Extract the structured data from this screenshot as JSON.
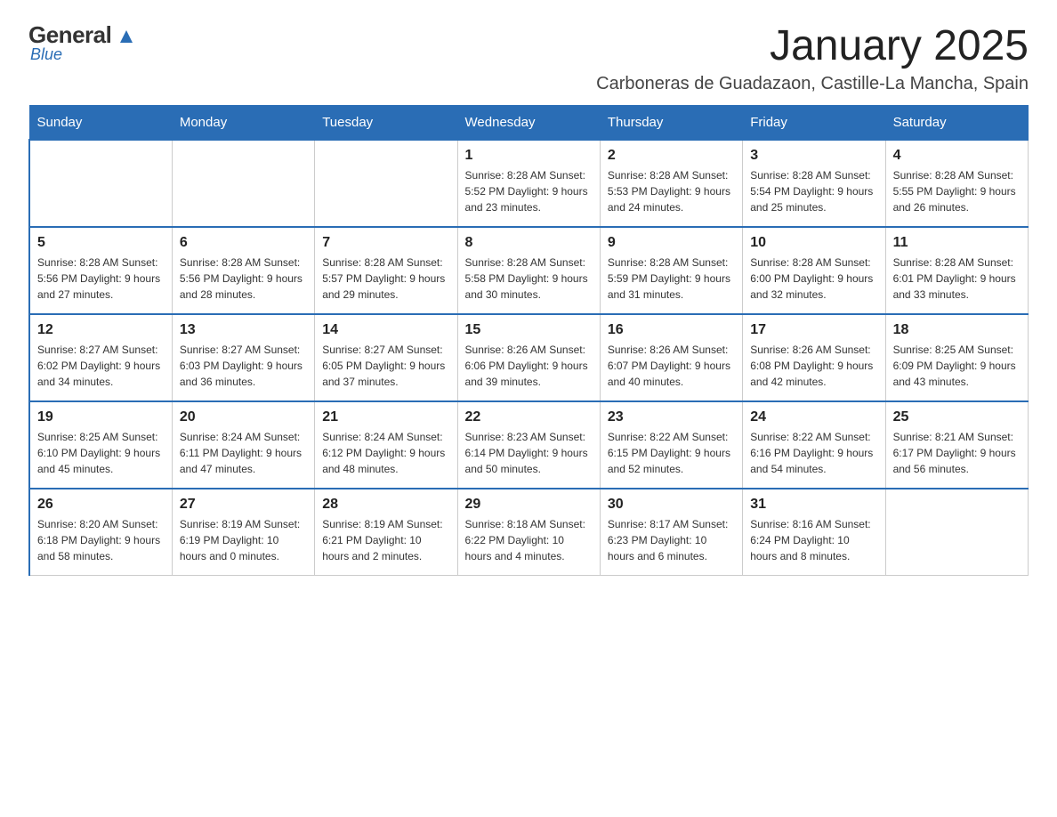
{
  "logo": {
    "brand1": "General",
    "brand2": "Blue"
  },
  "header": {
    "month_year": "January 2025",
    "location": "Carboneras de Guadazaon, Castille-La Mancha, Spain"
  },
  "weekdays": [
    "Sunday",
    "Monday",
    "Tuesday",
    "Wednesday",
    "Thursday",
    "Friday",
    "Saturday"
  ],
  "weeks": [
    [
      {
        "day": "",
        "info": ""
      },
      {
        "day": "",
        "info": ""
      },
      {
        "day": "",
        "info": ""
      },
      {
        "day": "1",
        "info": "Sunrise: 8:28 AM\nSunset: 5:52 PM\nDaylight: 9 hours and 23 minutes."
      },
      {
        "day": "2",
        "info": "Sunrise: 8:28 AM\nSunset: 5:53 PM\nDaylight: 9 hours and 24 minutes."
      },
      {
        "day": "3",
        "info": "Sunrise: 8:28 AM\nSunset: 5:54 PM\nDaylight: 9 hours and 25 minutes."
      },
      {
        "day": "4",
        "info": "Sunrise: 8:28 AM\nSunset: 5:55 PM\nDaylight: 9 hours and 26 minutes."
      }
    ],
    [
      {
        "day": "5",
        "info": "Sunrise: 8:28 AM\nSunset: 5:56 PM\nDaylight: 9 hours and 27 minutes."
      },
      {
        "day": "6",
        "info": "Sunrise: 8:28 AM\nSunset: 5:56 PM\nDaylight: 9 hours and 28 minutes."
      },
      {
        "day": "7",
        "info": "Sunrise: 8:28 AM\nSunset: 5:57 PM\nDaylight: 9 hours and 29 minutes."
      },
      {
        "day": "8",
        "info": "Sunrise: 8:28 AM\nSunset: 5:58 PM\nDaylight: 9 hours and 30 minutes."
      },
      {
        "day": "9",
        "info": "Sunrise: 8:28 AM\nSunset: 5:59 PM\nDaylight: 9 hours and 31 minutes."
      },
      {
        "day": "10",
        "info": "Sunrise: 8:28 AM\nSunset: 6:00 PM\nDaylight: 9 hours and 32 minutes."
      },
      {
        "day": "11",
        "info": "Sunrise: 8:28 AM\nSunset: 6:01 PM\nDaylight: 9 hours and 33 minutes."
      }
    ],
    [
      {
        "day": "12",
        "info": "Sunrise: 8:27 AM\nSunset: 6:02 PM\nDaylight: 9 hours and 34 minutes."
      },
      {
        "day": "13",
        "info": "Sunrise: 8:27 AM\nSunset: 6:03 PM\nDaylight: 9 hours and 36 minutes."
      },
      {
        "day": "14",
        "info": "Sunrise: 8:27 AM\nSunset: 6:05 PM\nDaylight: 9 hours and 37 minutes."
      },
      {
        "day": "15",
        "info": "Sunrise: 8:26 AM\nSunset: 6:06 PM\nDaylight: 9 hours and 39 minutes."
      },
      {
        "day": "16",
        "info": "Sunrise: 8:26 AM\nSunset: 6:07 PM\nDaylight: 9 hours and 40 minutes."
      },
      {
        "day": "17",
        "info": "Sunrise: 8:26 AM\nSunset: 6:08 PM\nDaylight: 9 hours and 42 minutes."
      },
      {
        "day": "18",
        "info": "Sunrise: 8:25 AM\nSunset: 6:09 PM\nDaylight: 9 hours and 43 minutes."
      }
    ],
    [
      {
        "day": "19",
        "info": "Sunrise: 8:25 AM\nSunset: 6:10 PM\nDaylight: 9 hours and 45 minutes."
      },
      {
        "day": "20",
        "info": "Sunrise: 8:24 AM\nSunset: 6:11 PM\nDaylight: 9 hours and 47 minutes."
      },
      {
        "day": "21",
        "info": "Sunrise: 8:24 AM\nSunset: 6:12 PM\nDaylight: 9 hours and 48 minutes."
      },
      {
        "day": "22",
        "info": "Sunrise: 8:23 AM\nSunset: 6:14 PM\nDaylight: 9 hours and 50 minutes."
      },
      {
        "day": "23",
        "info": "Sunrise: 8:22 AM\nSunset: 6:15 PM\nDaylight: 9 hours and 52 minutes."
      },
      {
        "day": "24",
        "info": "Sunrise: 8:22 AM\nSunset: 6:16 PM\nDaylight: 9 hours and 54 minutes."
      },
      {
        "day": "25",
        "info": "Sunrise: 8:21 AM\nSunset: 6:17 PM\nDaylight: 9 hours and 56 minutes."
      }
    ],
    [
      {
        "day": "26",
        "info": "Sunrise: 8:20 AM\nSunset: 6:18 PM\nDaylight: 9 hours and 58 minutes."
      },
      {
        "day": "27",
        "info": "Sunrise: 8:19 AM\nSunset: 6:19 PM\nDaylight: 10 hours and 0 minutes."
      },
      {
        "day": "28",
        "info": "Sunrise: 8:19 AM\nSunset: 6:21 PM\nDaylight: 10 hours and 2 minutes."
      },
      {
        "day": "29",
        "info": "Sunrise: 8:18 AM\nSunset: 6:22 PM\nDaylight: 10 hours and 4 minutes."
      },
      {
        "day": "30",
        "info": "Sunrise: 8:17 AM\nSunset: 6:23 PM\nDaylight: 10 hours and 6 minutes."
      },
      {
        "day": "31",
        "info": "Sunrise: 8:16 AM\nSunset: 6:24 PM\nDaylight: 10 hours and 8 minutes."
      },
      {
        "day": "",
        "info": ""
      }
    ]
  ]
}
